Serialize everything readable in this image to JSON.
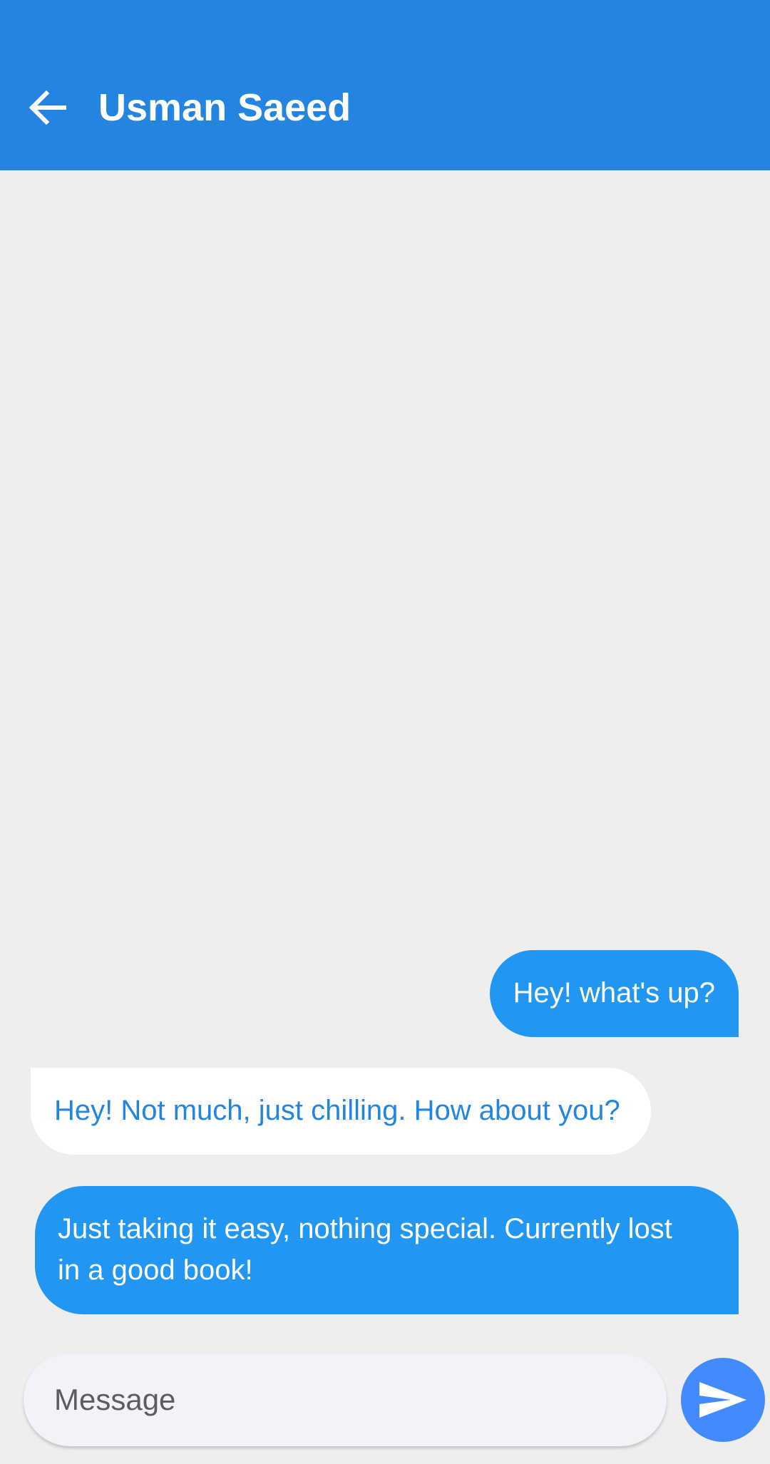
{
  "appbar": {
    "title": "Usman Saeed",
    "back_icon": "arrow-back-icon",
    "background_color": "#2385e0"
  },
  "messages": [
    {
      "sender": "me",
      "text": "Hey! what's up?"
    },
    {
      "sender": "other",
      "text": "Hey! Not much, just chilling. How about you?"
    },
    {
      "sender": "me",
      "text": "Just taking it easy, nothing special. Currently lost in a good book!"
    }
  ],
  "composer": {
    "placeholder": "Message",
    "value": "",
    "send_icon": "send-icon",
    "send_button_color": "#448aff"
  },
  "colors": {
    "sent_bubble": "#2196f3",
    "received_bubble": "#ffffff",
    "received_text": "#2385e0",
    "chat_background": "#eeeeee"
  }
}
